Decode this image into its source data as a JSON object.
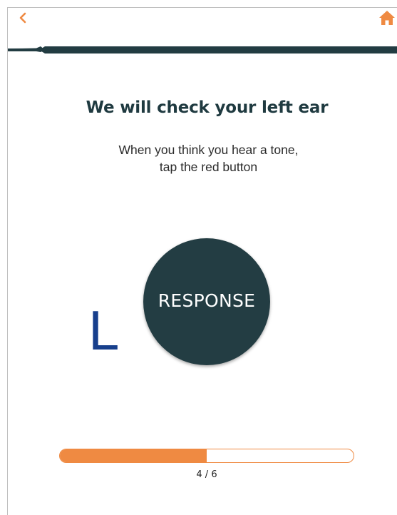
{
  "nav": {
    "back_icon": "chevron-left-icon",
    "home_icon": "home-icon"
  },
  "title": "We will check your left ear",
  "instruction": {
    "line1": "When you think you hear a tone,",
    "line2": "tap the red button"
  },
  "ear_label": "L",
  "response_button": {
    "label": "RESPONSE"
  },
  "progress": {
    "current": 4,
    "total": 6,
    "fraction": 0.5,
    "label": "4 / 6"
  },
  "colors": {
    "accent": "#ef8a42",
    "header_band": "#223c42",
    "button_bg": "#233d43",
    "title_text": "#1f3a40",
    "ear_letter": "#173f8c"
  }
}
